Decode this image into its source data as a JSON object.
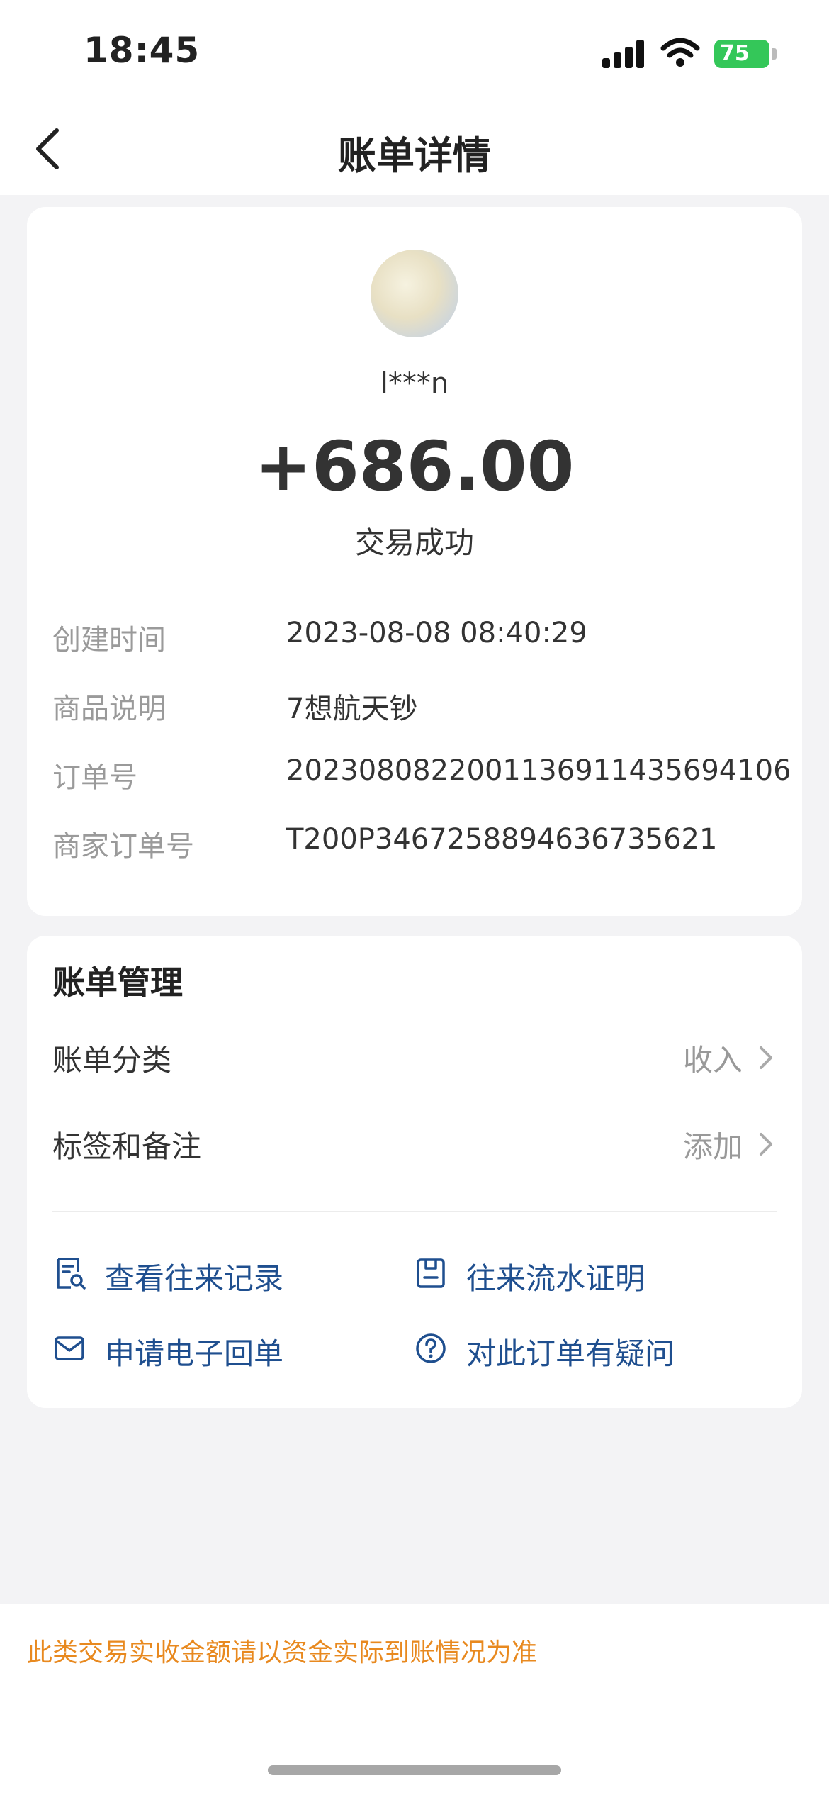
{
  "status_bar": {
    "time": "18:45",
    "battery": "75"
  },
  "nav": {
    "title": "账单详情"
  },
  "transaction": {
    "payee": "l***n",
    "amount": "+686.00",
    "status": "交易成功",
    "details": [
      {
        "label": "创建时间",
        "value": "2023-08-08 08:40:29"
      },
      {
        "label": "商品说明",
        "value": "7想航天钞"
      },
      {
        "label": "订单号",
        "value": "2023080822001136911435694106"
      },
      {
        "label": "商家订单号",
        "value": "T200P3467258894636735621"
      }
    ]
  },
  "management": {
    "title": "账单管理",
    "rows": [
      {
        "label": "账单分类",
        "value": "收入"
      },
      {
        "label": "标签和备注",
        "value": "添加"
      }
    ],
    "links": [
      {
        "label": "查看往来记录",
        "icon": "receipt-search-icon"
      },
      {
        "label": "往来流水证明",
        "icon": "document-icon"
      },
      {
        "label": "申请电子回单",
        "icon": "envelope-icon"
      },
      {
        "label": "对此订单有疑问",
        "icon": "question-circle-icon"
      }
    ]
  },
  "footer": {
    "note": "此类交易实收金额请以资金实际到账情况为准"
  },
  "colors": {
    "link": "#1f4f8f",
    "note": "#e8891f",
    "battery": "#34c759"
  }
}
